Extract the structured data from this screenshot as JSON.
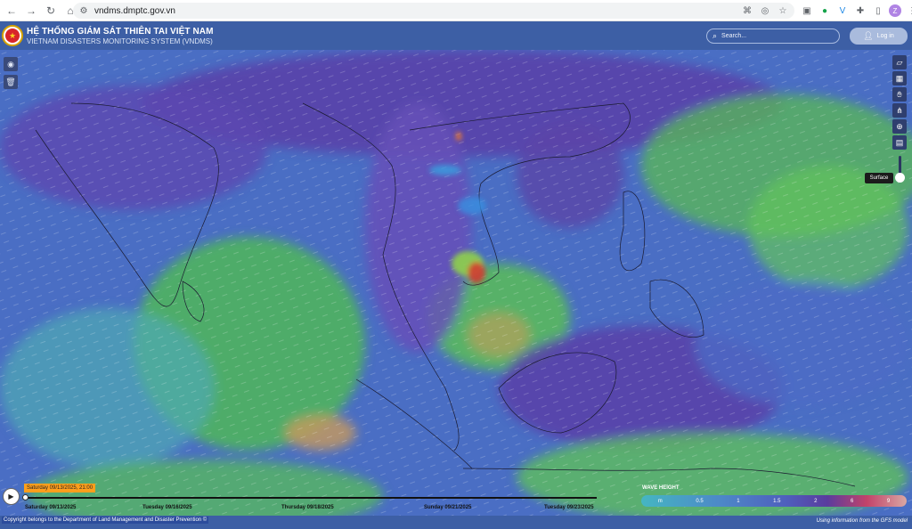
{
  "browser": {
    "url": "vndms.dmptc.gov.vn",
    "profile_initial": "Z"
  },
  "header": {
    "title_vn": "HỆ THỐNG GIÁM SÁT THIÊN TAI VIỆT NAM",
    "title_en": "VIETNAM DISASTERS MONITORING SYSTEM (VNDMS)",
    "search_placeholder": "Search...",
    "login_label": "Log in"
  },
  "map": {
    "layer_tooltip": "Surface"
  },
  "timeline": {
    "current": "Saturday 09/13/2025, 21:00",
    "days": [
      "Saturday 09/13/2025",
      "Tuesday 09/16/2025",
      "Thursday 09/18/2025",
      "Sunday 09/21/2025",
      "Tuesday 09/23/2025"
    ]
  },
  "legend": {
    "title": "WAVE HEIGHT",
    "labels": [
      "m",
      "0.5",
      "1",
      "1.5",
      "2",
      "6",
      "9"
    ],
    "colors": [
      "#45b6c2",
      "#4d88c8",
      "#4f5ebd",
      "#5a3c9e",
      "#c2436a",
      "#d9a7a3"
    ]
  },
  "footer": {
    "copyright": "Copyright belongs to the Department of Land Management and Disaster Prevention ©",
    "source": "Using information from the GFS model"
  }
}
